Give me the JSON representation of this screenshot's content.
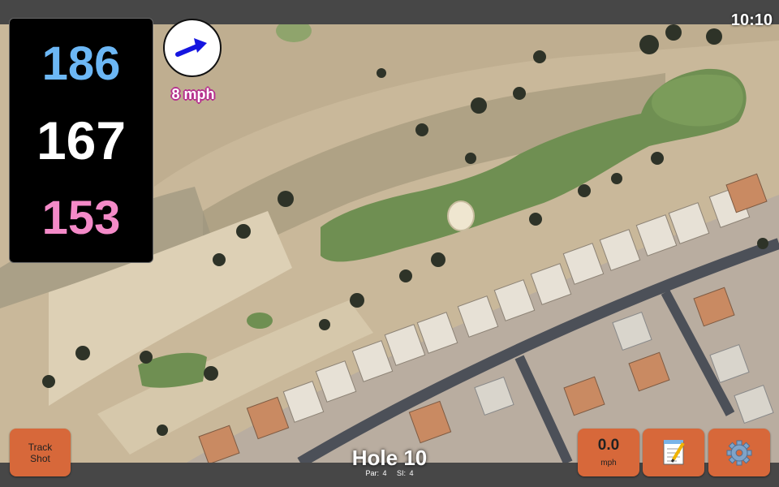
{
  "status": {
    "clock": "10:10"
  },
  "distances": {
    "back": "186",
    "middle": "167",
    "front": "153",
    "colors": {
      "back": "#6cb7f5",
      "middle": "#ffffff",
      "front": "#f48ac8"
    }
  },
  "wind": {
    "speed": "8 mph",
    "direction_icon": "arrow-icon",
    "arrow_color": "#1515e0"
  },
  "map": {
    "type": "satellite",
    "icons": [
      "green",
      "bunker",
      "fairway",
      "houses",
      "road"
    ]
  },
  "buttons": {
    "track_shot_line1": "Track",
    "track_shot_line2": "Shot",
    "speed_value": "0.0",
    "speed_unit": "mph",
    "notes_icon": "notepad-icon",
    "settings_icon": "gear-icon",
    "accent": "#d7683a"
  },
  "hole": {
    "title": "Hole 10",
    "par": "Par: 4",
    "si": "SI: 4"
  }
}
